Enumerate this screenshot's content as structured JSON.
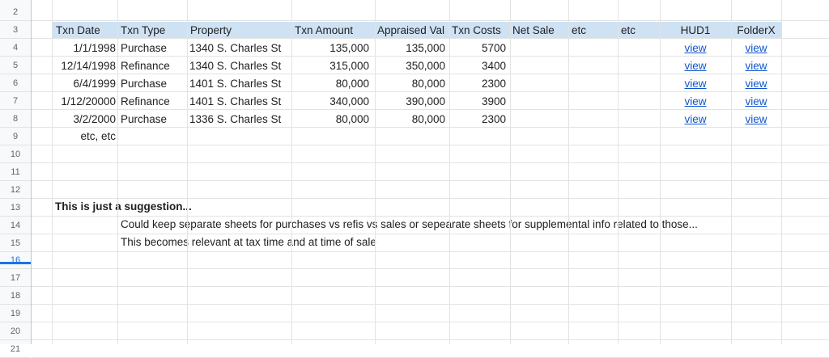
{
  "row_numbers": [
    "2",
    "3",
    "4",
    "5",
    "6",
    "7",
    "8",
    "9",
    "10",
    "11",
    "12",
    "13",
    "14",
    "15",
    "16",
    "17",
    "18",
    "19",
    "20",
    "21"
  ],
  "selected_row": "16",
  "headers": [
    "Txn Date",
    "Txn Type",
    "Property",
    "Txn Amount",
    "Appraised Val",
    "Txn Costs",
    "Net Sale",
    "etc",
    "etc",
    "HUD1",
    "FolderX"
  ],
  "rows": [
    [
      "1/1/1998",
      "Purchase",
      "1340 S. Charles St",
      "135,000",
      "135,000",
      "5700",
      "",
      "",
      "",
      "view",
      "view"
    ],
    [
      "12/14/1998",
      "Refinance",
      "1340 S. Charles St",
      "315,000",
      "350,000",
      "3400",
      "",
      "",
      "",
      "view",
      "view"
    ],
    [
      "6/4/1999",
      "Purchase",
      "1401 S. Charles St",
      "80,000",
      "80,000",
      "2300",
      "",
      "",
      "",
      "view",
      "view"
    ],
    [
      "1/12/20000",
      "Refinance",
      "1401 S. Charles St",
      "340,000",
      "390,000",
      "3900",
      "",
      "",
      "",
      "view",
      "view"
    ],
    [
      "3/2/2000",
      "Purchase",
      "1336 S. Charles St",
      "80,000",
      "80,000",
      "2300",
      "",
      "",
      "",
      "view",
      "view"
    ]
  ],
  "etc_note": "etc, etc",
  "notes": {
    "title": "This is just a suggestion...",
    "line1": "Could keep separate sheets for purchases vs refis vs sales or sepearate sheets for supplemental info related to those...",
    "line2": "This becomes relevant at tax time and at time of sale"
  },
  "colors": {
    "header_bg": "#cfe2f3",
    "link": "#1155cc",
    "selection": "#1a73e8"
  }
}
